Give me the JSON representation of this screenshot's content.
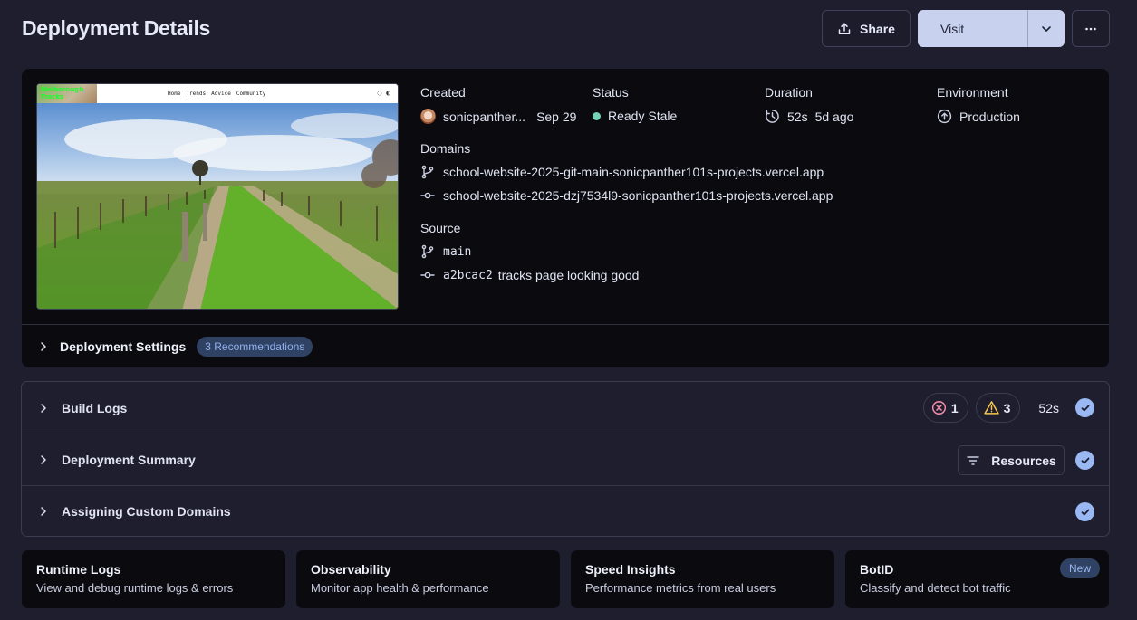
{
  "page": {
    "title": "Deployment Details"
  },
  "header": {
    "share_label": "Share",
    "visit_label": "Visit",
    "more_icon": "more-horizontal-icon"
  },
  "preview": {
    "logo_text": "Melborough Tracks",
    "nav_links": [
      "Home",
      "Trends",
      "Advice",
      "Community"
    ]
  },
  "meta": {
    "created": {
      "label": "Created",
      "user": "sonicpanther...",
      "date": "Sep 29"
    },
    "status": {
      "label": "Status",
      "value": "Ready Stale",
      "color": "#74d2b5"
    },
    "duration": {
      "label": "Duration",
      "value": "52s",
      "ago": "5d ago"
    },
    "environment": {
      "label": "Environment",
      "value": "Production"
    }
  },
  "domains": {
    "label": "Domains",
    "items": [
      "school-website-2025-git-main-sonicpanther101s-projects.vercel.app",
      "school-website-2025-dzj7534l9-sonicpanther101s-projects.vercel.app"
    ]
  },
  "source": {
    "label": "Source",
    "branch": "main",
    "commit_hash": "a2bcac2",
    "commit_message": "tracks page looking good"
  },
  "settings": {
    "title": "Deployment Settings",
    "badge": "3 Recommendations"
  },
  "logs": [
    {
      "title": "Build Logs",
      "errors": "1",
      "warnings": "3",
      "duration": "52s"
    },
    {
      "title": "Deployment Summary",
      "button": "Resources"
    },
    {
      "title": "Assigning Custom Domains"
    }
  ],
  "cards": [
    {
      "title": "Runtime Logs",
      "desc": "View and debug runtime logs & errors"
    },
    {
      "title": "Observability",
      "desc": "Monitor app health & performance"
    },
    {
      "title": "Speed Insights",
      "desc": "Performance metrics from real users"
    },
    {
      "title": "BotID",
      "desc": "Classify and detect bot traffic",
      "badge": "New"
    }
  ],
  "colors": {
    "accent": "#9ab8f2",
    "visit_bg": "#c8d2ef",
    "error": "#f38ba8",
    "warning": "#f9c74f"
  }
}
